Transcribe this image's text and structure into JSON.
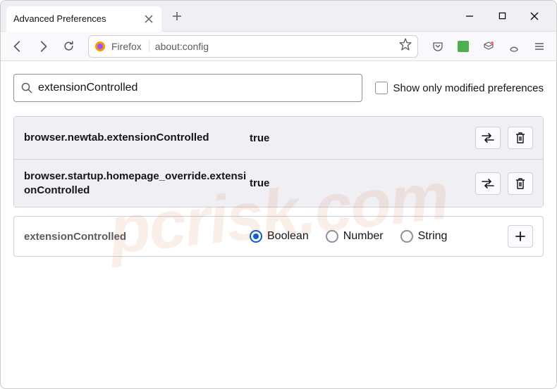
{
  "window": {
    "tab_title": "Advanced Preferences"
  },
  "urlbar": {
    "identity_label": "Firefox",
    "url": "about:config"
  },
  "search": {
    "value": "extensionControlled",
    "checkbox_label": "Show only modified preferences"
  },
  "prefs": [
    {
      "name": "browser.newtab.extensionControlled",
      "value": "true"
    },
    {
      "name": "browser.startup.homepage_override.extensionControlled",
      "value": "true"
    }
  ],
  "new_pref": {
    "name": "extensionControlled",
    "types": [
      "Boolean",
      "Number",
      "String"
    ],
    "selected": "Boolean"
  },
  "watermark": "pcrisk.com"
}
